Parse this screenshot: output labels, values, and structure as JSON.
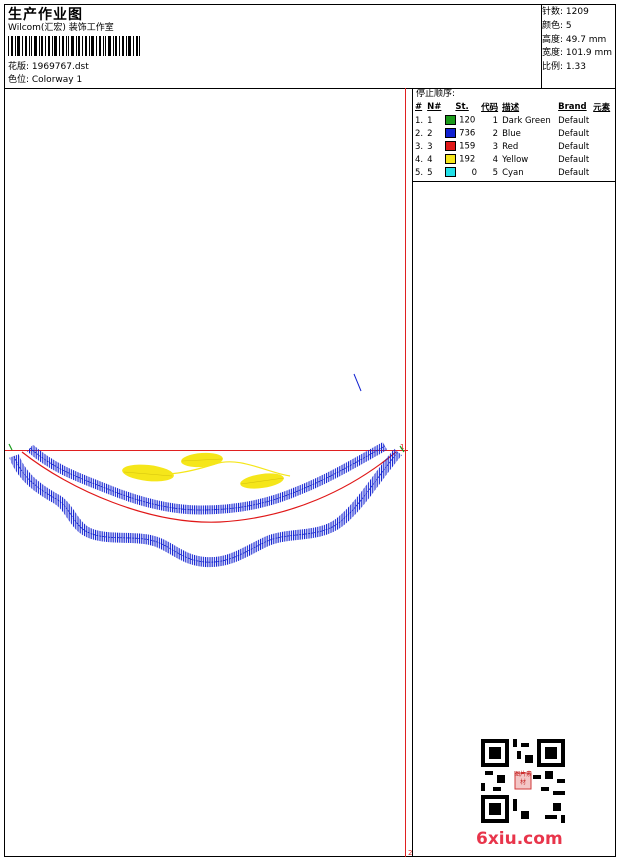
{
  "header": {
    "title": "生产作业图",
    "company": "Wilcom(汇宏) 装饰工作室",
    "design_file": "花版: 1969767.dst",
    "colorway": "色位: Colorway 1"
  },
  "stats": {
    "stitches": "针数: 1209",
    "colors": "颜色: 5",
    "height": "高度: 49.7 mm",
    "width": "宽度: 101.9 mm",
    "ratio": "比例: 1.33"
  },
  "stop_sequence": {
    "title": "停止顺序:",
    "headers": [
      "#",
      "N#",
      "St.",
      "代码",
      "描述",
      "Brand",
      "元素"
    ],
    "rows": [
      {
        "idx": "1.",
        "n": "1",
        "st": "120",
        "code": "1",
        "desc": "Dark Green",
        "brand": "Default",
        "color": "#1a9a1a"
      },
      {
        "idx": "2.",
        "n": "2",
        "st": "736",
        "code": "2",
        "desc": "Blue",
        "brand": "Default",
        "color": "#1020d0"
      },
      {
        "idx": "3.",
        "n": "3",
        "st": "159",
        "code": "3",
        "desc": "Red",
        "brand": "Default",
        "color": "#e01818"
      },
      {
        "idx": "4.",
        "n": "4",
        "st": "192",
        "code": "4",
        "desc": "Yellow",
        "brand": "Default",
        "color": "#f5e61a"
      },
      {
        "idx": "5.",
        "n": "5",
        "st": "0",
        "code": "5",
        "desc": "Cyan",
        "brand": "Default",
        "color": "#22e0e8"
      }
    ]
  },
  "canvas": {
    "marker_right": "1",
    "marker_bottom": "2"
  },
  "watermark": "6xiu.com",
  "stamp_text": "图片素材"
}
